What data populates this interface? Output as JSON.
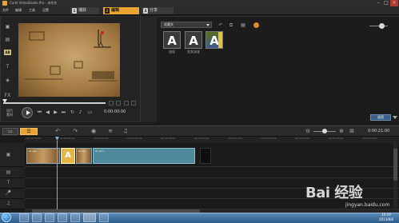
{
  "window": {
    "title": "Corel VideoStudio Pro - 未命名"
  },
  "menu": [
    "文件",
    "编辑",
    "工具",
    "设置"
  ],
  "steps": [
    {
      "num": "1",
      "label": "捕获"
    },
    {
      "num": "2",
      "label": "编辑"
    },
    {
      "num": "3",
      "label": "分享"
    }
  ],
  "player": {
    "mode_label": "项目\n素材",
    "timecode": "0:00:00:00"
  },
  "library": {
    "category": "收藏夹",
    "thumbnails": [
      {
        "glyph": "A",
        "label": "淡化"
      },
      {
        "glyph": "A",
        "label": "交叉淡化"
      },
      {
        "glyph": "A",
        "label": ""
      }
    ],
    "options_label": "选项"
  },
  "timeline": {
    "total_time": "0:00:21:00",
    "ruler": [
      "00:00:00:00",
      "00:00:02:00",
      "00:00:04:00",
      "00:00:06:00",
      "00:00:08:00",
      "00:00:10:00",
      "00:00:12:00",
      "00:00:14:00",
      "00:00:16:00",
      "00:00:18:00",
      "00:00:20:00"
    ],
    "clips": {
      "c1": "01.jpg",
      "c2": "",
      "c3": "02.jpg",
      "wide": "01.wmv"
    }
  },
  "taskbar": {
    "time": "10:19",
    "date": "2013/8/8"
  },
  "watermark": {
    "brand": "Bai 经验",
    "url": "jingyan.baidu.com"
  }
}
